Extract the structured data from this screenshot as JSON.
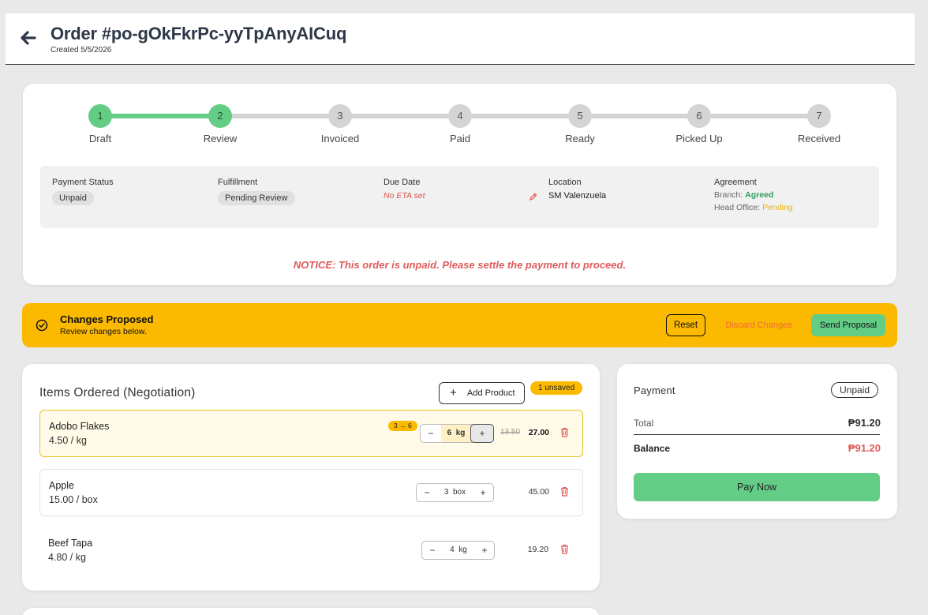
{
  "header": {
    "title": "Order #po-gOkFkrPc-yyTpAnyAICuq",
    "created": "Created 5/5/2026"
  },
  "progress": {
    "current_step": 2,
    "steps": [
      {
        "number": "1",
        "label": "Draft",
        "done": true
      },
      {
        "number": "2",
        "label": "Review",
        "done": true
      },
      {
        "number": "3",
        "label": "Invoiced",
        "done": false
      },
      {
        "number": "4",
        "label": "Paid",
        "done": false
      },
      {
        "number": "5",
        "label": "Ready",
        "done": false
      },
      {
        "number": "6",
        "label": "Picked Up",
        "done": false
      },
      {
        "number": "7",
        "label": "Received",
        "done": false
      }
    ]
  },
  "info": {
    "payment_status_label": "Payment Status",
    "payment_status": "Unpaid",
    "fulfillment_label": "Fulfillment",
    "fulfillment": "Pending Review",
    "due_date_label": "Due Date",
    "due_date": "No ETA set",
    "location_label": "Location",
    "location": "SM Valenzuela",
    "agreement_label": "Agreement",
    "branch_label": "Branch:",
    "branch_status": "Agreed",
    "head_office_label": "Head Office:",
    "head_office_status": "Pending"
  },
  "notice": "NOTICE: This order is unpaid. Please settle the payment to proceed.",
  "banner": {
    "title": "Changes Proposed",
    "subtitle": "Review changes below.",
    "reset_label": "Reset",
    "discard_label": "Discard Changes",
    "send_label": "Send Proposal"
  },
  "items_section": {
    "title": "Items Ordered (Negotiation)",
    "add_product_label": "Add Product",
    "unsaved_badge": "1 unsaved",
    "items": [
      {
        "name": "Adobo Flakes",
        "unit_price": "4.50 / kg",
        "change_badge": "3 → 6",
        "qty": "6",
        "unit": "kg",
        "old_total": "13.50",
        "total": "27.00"
      },
      {
        "name": "Apple",
        "unit_price": "15.00 / box",
        "qty": "3",
        "unit": "box",
        "total": "45.00"
      },
      {
        "name": "Beef Tapa",
        "unit_price": "4.80 / kg",
        "qty": "4",
        "unit": "kg",
        "total": "19.20"
      }
    ]
  },
  "payment": {
    "title": "Payment",
    "status": "Unpaid",
    "total_label": "Total",
    "total": "₱91.20",
    "balance_label": "Balance",
    "balance": "₱91.20",
    "pay_button": "Pay Now"
  },
  "colors": {
    "accent_green": "#63cc85",
    "warning_yellow": "#fbb900",
    "danger_red": "#e05a5a"
  }
}
